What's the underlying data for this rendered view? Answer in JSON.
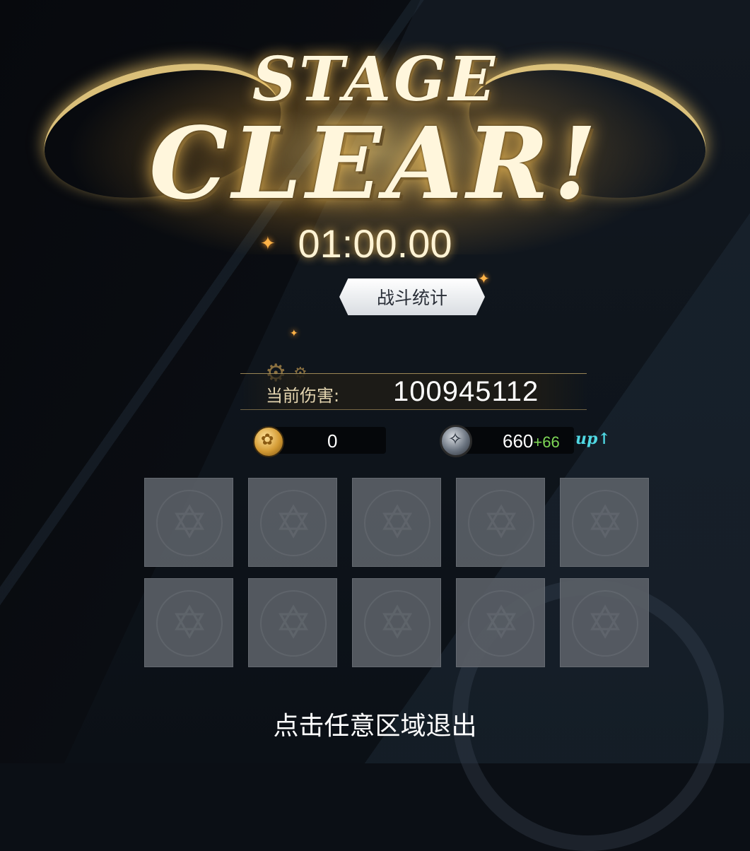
{
  "title": {
    "line1": "STAGE",
    "line2": "CLEAR!"
  },
  "timer": "01:00.00",
  "stats_button": "战斗统计",
  "damage": {
    "label": "当前伤害:",
    "value": "100945112"
  },
  "resources": {
    "gold": {
      "icon": "gold-coin-icon",
      "value": "0"
    },
    "silver": {
      "icon": "silver-coin-icon",
      "value": "660",
      "bonus": "+66",
      "badge": "up"
    }
  },
  "reward_slots": {
    "count": 10,
    "state": "empty",
    "icon": "hexagram-emblem-icon"
  },
  "exit_hint": "点击任意区域退出",
  "colors": {
    "title_glow": "#ffd678",
    "bonus_green": "#7ed957",
    "up_cyan": "#4fd7e2",
    "slot_gray": "#5a5f66"
  }
}
